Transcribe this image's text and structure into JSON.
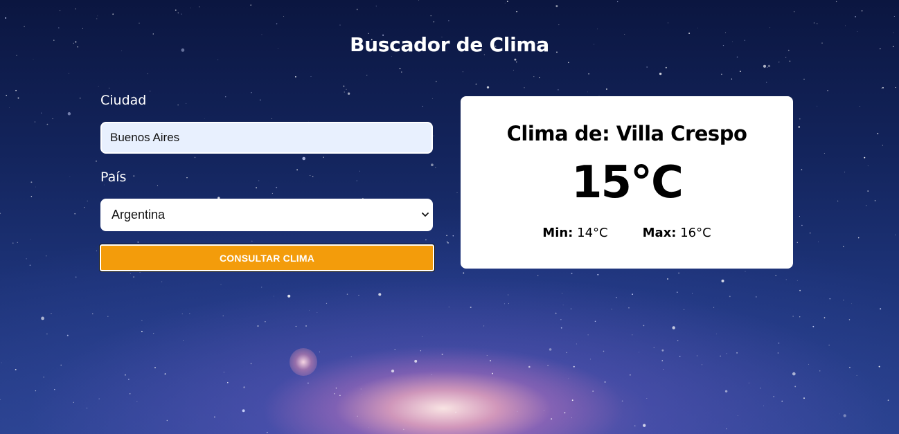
{
  "page": {
    "title": "Buscador de Clima"
  },
  "form": {
    "city_label": "Ciudad",
    "city_value": "Buenos Aires",
    "country_label": "País",
    "country_selected": "Argentina",
    "submit_label": "CONSULTAR CLIMA"
  },
  "result": {
    "heading": "Clima de: Villa Crespo",
    "temperature": "15°C",
    "min_label": "Min:",
    "min_value": "14°C",
    "max_label": "Max:",
    "max_value": "16°C"
  },
  "colors": {
    "accent_button": "#f39c0b",
    "card_background": "#ffffff",
    "input_background": "#e8f0fe",
    "background_top": "#0b1640"
  },
  "icons": {
    "select_arrow": "chevron-down-icon"
  }
}
